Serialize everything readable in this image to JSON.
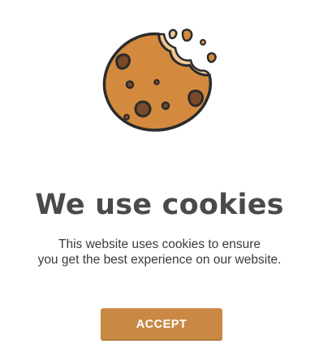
{
  "illustration": {
    "icon": "cookie-icon",
    "colors": {
      "dough": "#d48a3e",
      "edge": "#f0c896",
      "chips": "#7a4a2a",
      "outline": "#2b2b2b"
    }
  },
  "banner": {
    "title": "We use cookies",
    "description_line_1": "This website uses cookies to ensure",
    "description_line_2": "you get the best experience on our website.",
    "accept_label": "ACCEPT"
  },
  "colors": {
    "title": "#4a4a4a",
    "text": "#3b3b3b",
    "button": "#c98944",
    "button_text": "#ffffff"
  }
}
